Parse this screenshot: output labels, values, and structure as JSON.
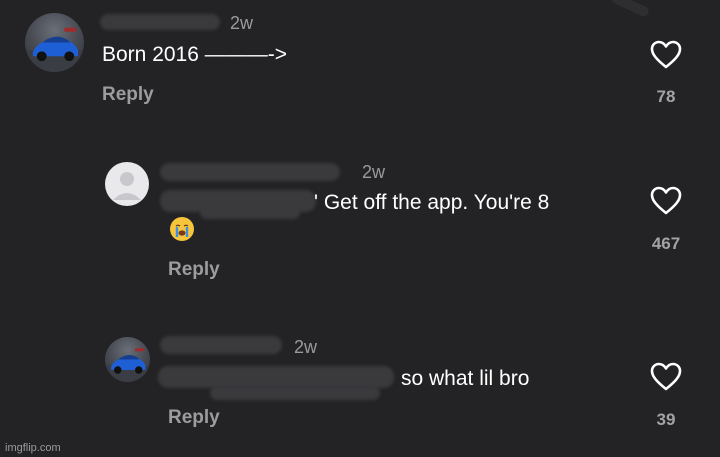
{
  "comments": [
    {
      "time": "2w",
      "text": "Born 2016 ———->",
      "reply_label": "Reply",
      "likes": "78",
      "avatar": "car-avatar",
      "heart_icon": "heart-outline-icon"
    },
    {
      "time": "2w",
      "text": "' Get off the app. You're 8",
      "reply_label": "Reply",
      "likes": "467",
      "avatar": "default-avatar",
      "emoji": "loudly-crying-face",
      "heart_icon": "heart-outline-icon"
    },
    {
      "time": "2w",
      "text": "so what lil bro",
      "reply_label": "Reply",
      "likes": "39",
      "avatar": "car-avatar",
      "heart_icon": "heart-outline-icon"
    }
  ],
  "watermark": "imgflip.com",
  "colors": {
    "background": "#232325",
    "text": "#ffffff",
    "muted": "#9c9c9f",
    "redaction": "#3a3a3d"
  }
}
